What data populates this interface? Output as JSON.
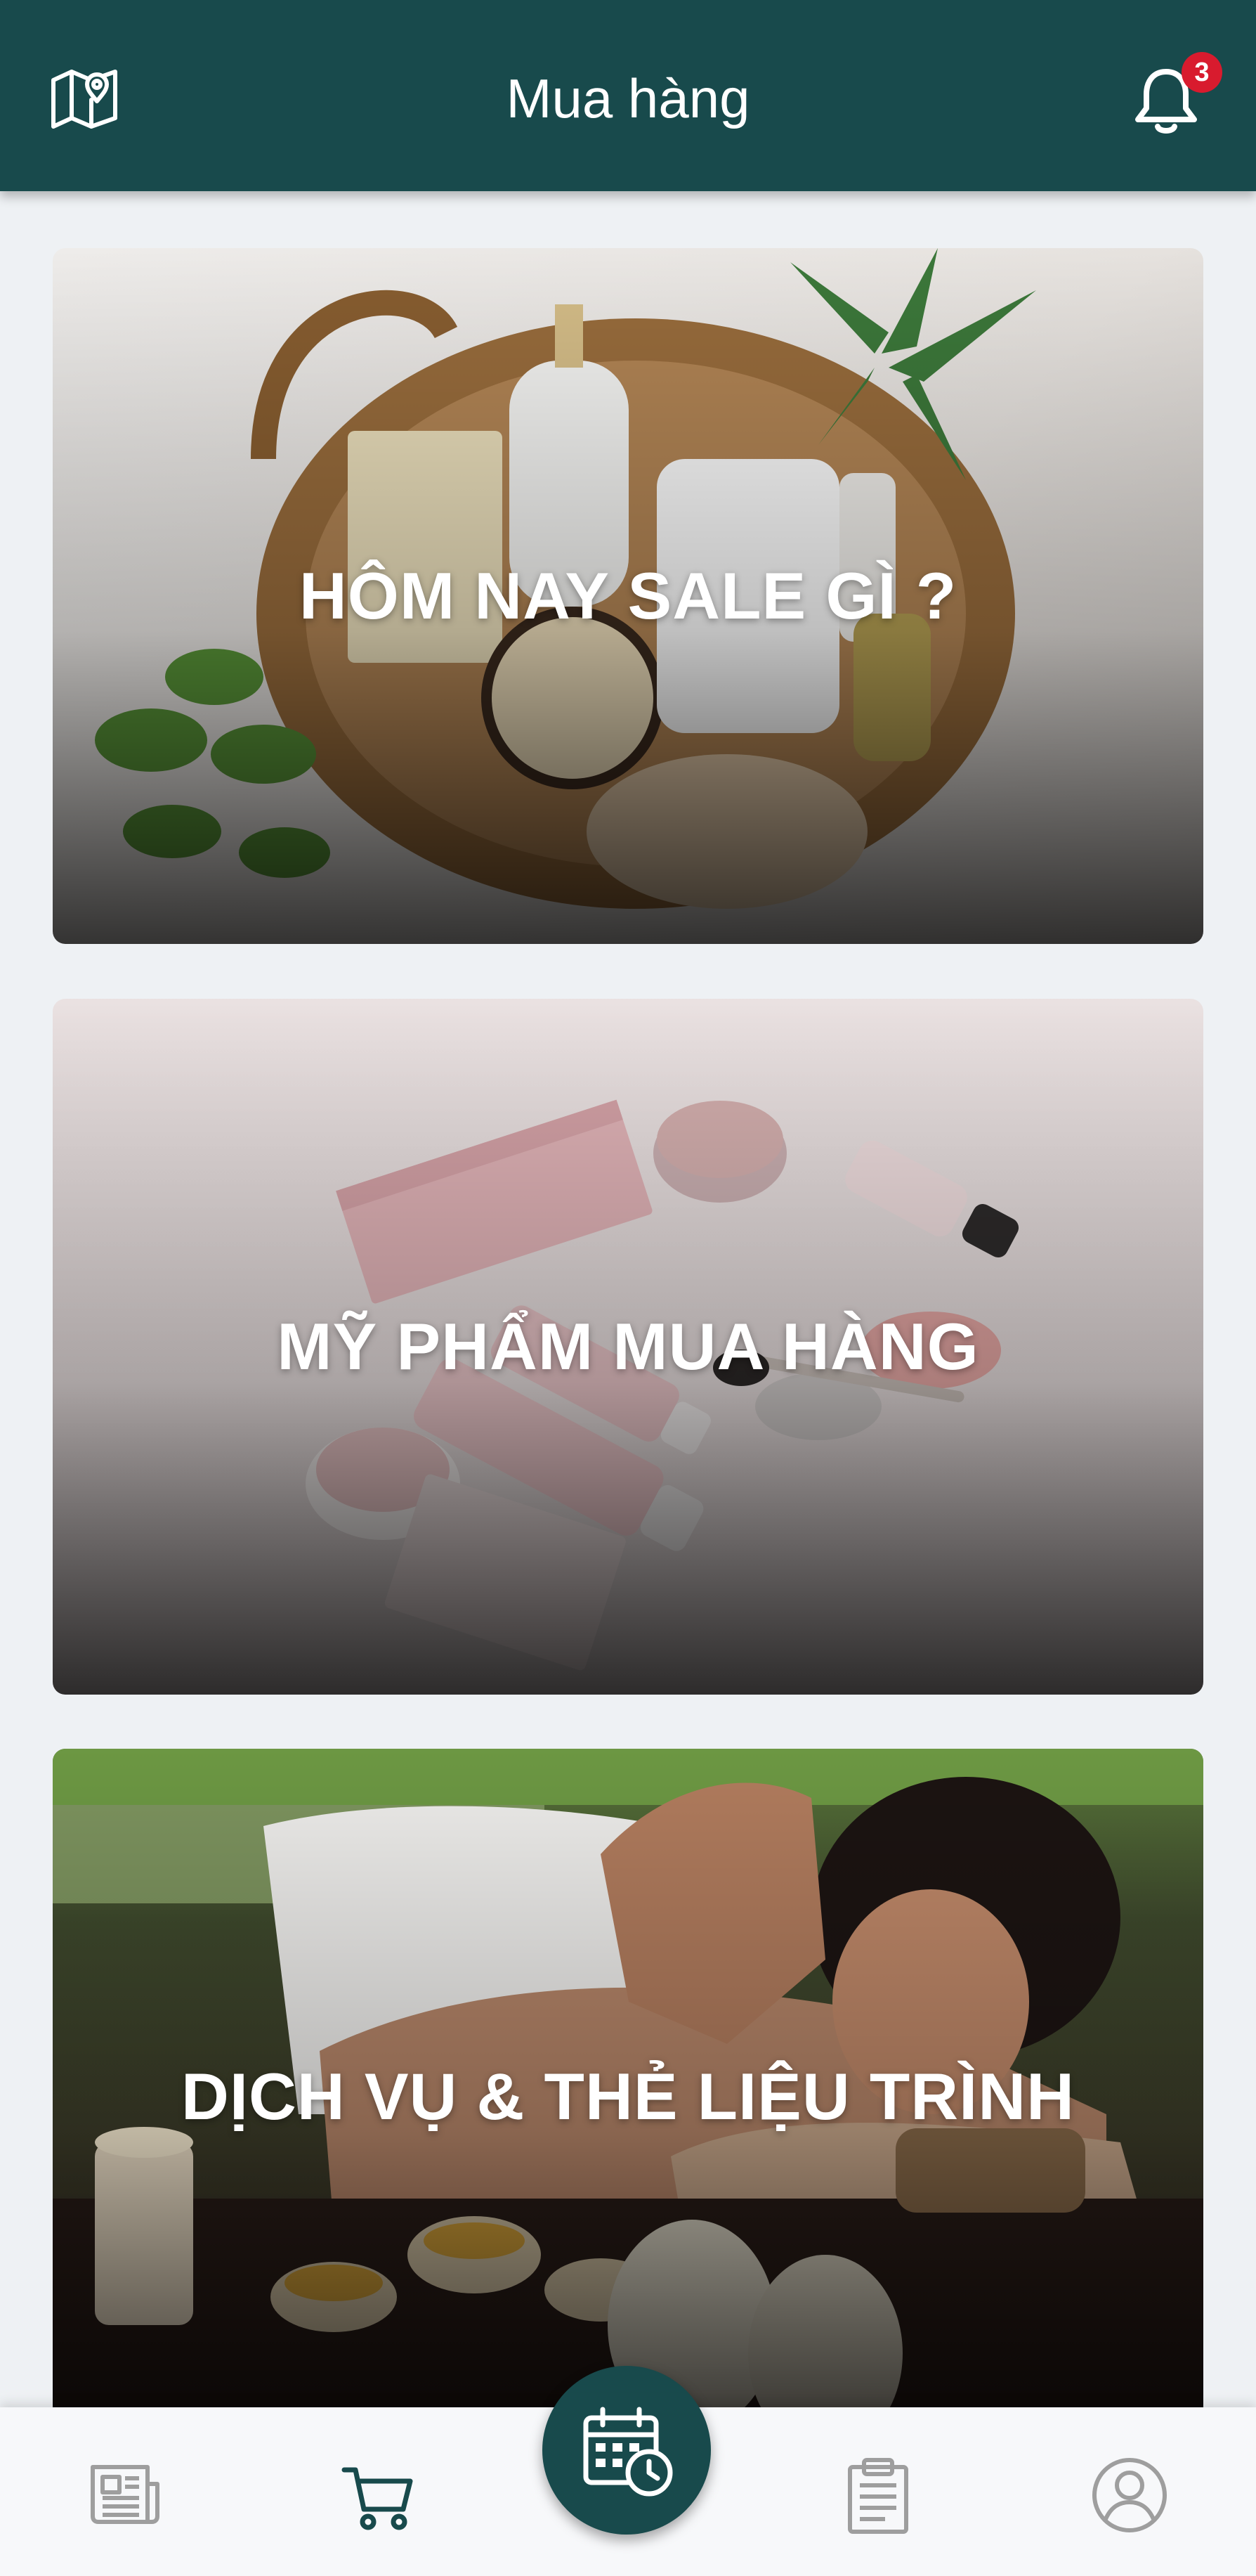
{
  "header": {
    "title": "Mua hàng",
    "notification_count": "3",
    "left_icon": "map-pin-icon",
    "right_icon": "bell-icon"
  },
  "cards": [
    {
      "label": "HÔM NAY SALE GÌ ?",
      "image": "spa-basket-photo"
    },
    {
      "label": "MỸ PHẨM MUA HÀNG",
      "image": "cosmetics-products-photo"
    },
    {
      "label": "DỊCH VỤ & THẺ LIỆU TRÌNH",
      "image": "massage-photo"
    }
  ],
  "bottom_nav": {
    "items": [
      {
        "icon": "news-icon",
        "active": false
      },
      {
        "icon": "cart-icon",
        "active": true
      },
      {
        "icon": "calendar-clock-icon",
        "active": false,
        "center": true
      },
      {
        "icon": "clipboard-icon",
        "active": false
      },
      {
        "icon": "account-icon",
        "active": false
      }
    ]
  },
  "colors": {
    "primary": "#184a4c",
    "badge": "#d81b2e",
    "background": "#eef1f4",
    "nav_inactive": "#9e9e9e"
  }
}
